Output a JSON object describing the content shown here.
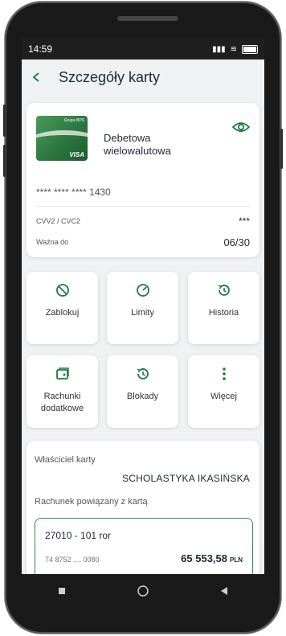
{
  "status": {
    "time": "14:59",
    "battery": "100"
  },
  "header": {
    "title": "Szczegóły karty",
    "back_icon": "chevron-left-icon"
  },
  "card": {
    "name_line1": "Debetowa",
    "name_line2": "wielowalutowa",
    "brand": "Grupa BPS",
    "network": "VISA",
    "number": "**** **** **** 1430",
    "cvv_label": "CVV2 / CVC2",
    "cvv_value": "***",
    "valid_label": "Ważna do",
    "valid_value": "06/30"
  },
  "actions": [
    {
      "label": "Zablokuj",
      "icon": "block-icon"
    },
    {
      "label": "Limity",
      "icon": "gauge-icon"
    },
    {
      "label": "Historia",
      "icon": "history-icon"
    },
    {
      "label": "Rachunki dodatkowe",
      "icon": "add-account-icon"
    },
    {
      "label": "Blokady",
      "icon": "history-icon"
    },
    {
      "label": "Więcej",
      "icon": "more-vertical-icon"
    }
  ],
  "owner": {
    "label": "Właściciel karty",
    "name": "SCHOLASTYKA IKASIŃSKA",
    "account_label": "Rachunek powiązany z kartą",
    "account_name": "27010 - 101 ror",
    "account_number": "74 8752 .... 0080",
    "amount": "65 553,58",
    "currency": "PLN"
  },
  "colors": {
    "accent": "#1e7a3f",
    "background": "#f0f1f3"
  }
}
